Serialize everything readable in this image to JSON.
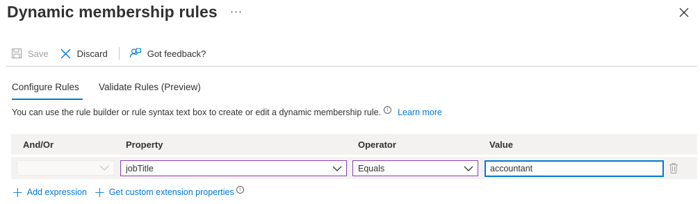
{
  "header": {
    "title": "Dynamic membership rules",
    "more_label": "···",
    "close_icon": "close-icon"
  },
  "toolbar": {
    "save_label": "Save",
    "discard_label": "Discard",
    "feedback_label": "Got feedback?"
  },
  "tabs": [
    {
      "label": "Configure Rules",
      "active": true
    },
    {
      "label": "Validate Rules (Preview)",
      "active": false
    }
  ],
  "description": {
    "text": "You can use the rule builder or rule syntax text box to create or edit a dynamic membership rule.",
    "info_glyph": "i",
    "learn_more": "Learn more"
  },
  "grid": {
    "headers": {
      "andor": "And/Or",
      "property": "Property",
      "operator": "Operator",
      "value": "Value"
    },
    "row": {
      "andor": "",
      "property": "jobTitle",
      "operator": "Equals",
      "value": "accountant"
    }
  },
  "actions": {
    "add_expression": "Add expression",
    "get_custom": "Get custom extension properties",
    "info_glyph": "i"
  },
  "colors": {
    "accent": "#0078d4",
    "focus_border": "#8a3fb5",
    "row_background": "#f3f2f1"
  }
}
